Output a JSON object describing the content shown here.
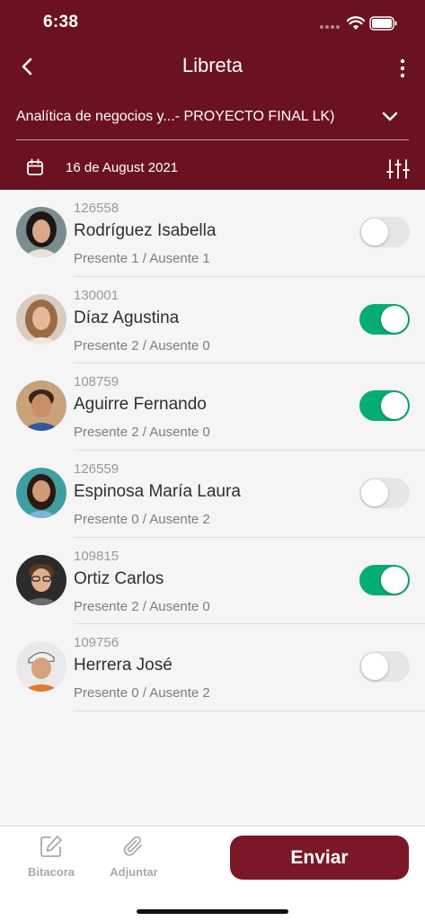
{
  "status_bar": {
    "time": "6:38"
  },
  "header": {
    "title": "Libreta",
    "course": "Analítica de negocios y...- PROYECTO FINAL  LK)",
    "date": "16 de August 2021"
  },
  "students": [
    {
      "id": "126558",
      "name": "Rodríguez Isabella",
      "summary": "Presente 1 / Ausente 1",
      "present": false
    },
    {
      "id": "130001",
      "name": "Díaz Agustina",
      "summary": "Presente 2 / Ausente 0",
      "present": true
    },
    {
      "id": "108759",
      "name": "Aguirre Fernando",
      "summary": "Presente 2 / Ausente 0",
      "present": true
    },
    {
      "id": "126559",
      "name": "Espinosa María Laura",
      "summary": "Presente 0 / Ausente 2",
      "present": false
    },
    {
      "id": "109815",
      "name": "Ortiz Carlos",
      "summary": "Presente 2 / Ausente 0",
      "present": true
    },
    {
      "id": "109756",
      "name": "Herrera José",
      "summary": "Presente 0 / Ausente 2",
      "present": false
    }
  ],
  "toolbar": {
    "bitacora_label": "Bitacora",
    "adjuntar_label": "Adjuntar",
    "send_label": "Enviar"
  },
  "colors": {
    "header": "#6b1220",
    "toggle_on": "#06ad73",
    "send_button": "#7a1827"
  }
}
